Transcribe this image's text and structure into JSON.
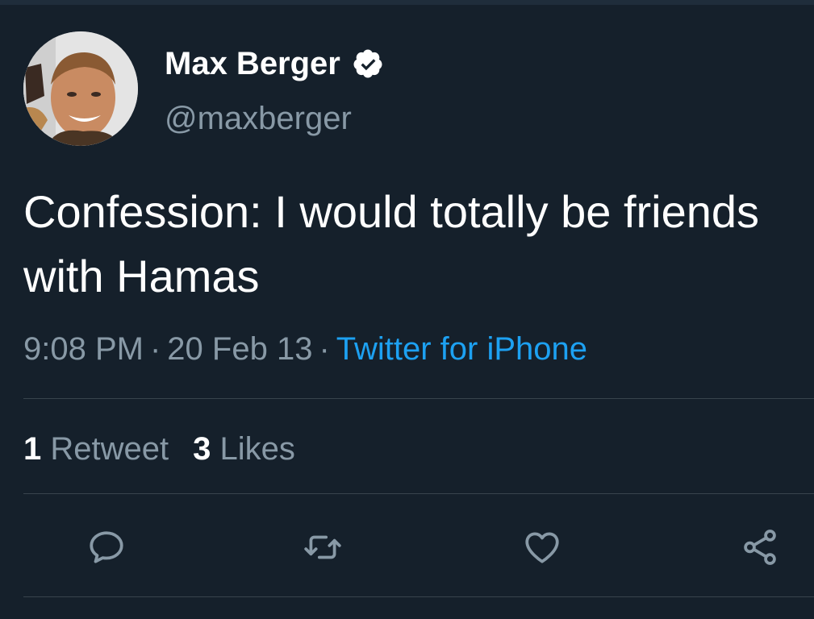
{
  "tweet": {
    "author": {
      "display_name": "Max Berger",
      "handle": "@maxberger",
      "verified": true,
      "avatar_icon": "profile-photo"
    },
    "text": "Confession: I would totally be friends with Hamas",
    "time": "9:08 PM",
    "date": "20 Feb 13",
    "separator": "·",
    "source": "Twitter for iPhone",
    "source_color": "#1da1f2"
  },
  "stats": {
    "retweets_count": "1",
    "retweets_label": "Retweet",
    "likes_count": "3",
    "likes_label": "Likes"
  },
  "actions": [
    {
      "name": "reply",
      "icon": "comment-icon"
    },
    {
      "name": "retweet",
      "icon": "retweet-icon"
    },
    {
      "name": "like",
      "icon": "heart-icon"
    },
    {
      "name": "share",
      "icon": "share-icon"
    }
  ],
  "colors": {
    "background": "#15202b",
    "text_primary": "#ffffff",
    "text_secondary": "#8899a6",
    "divider": "#38444d",
    "link": "#1da1f2"
  }
}
